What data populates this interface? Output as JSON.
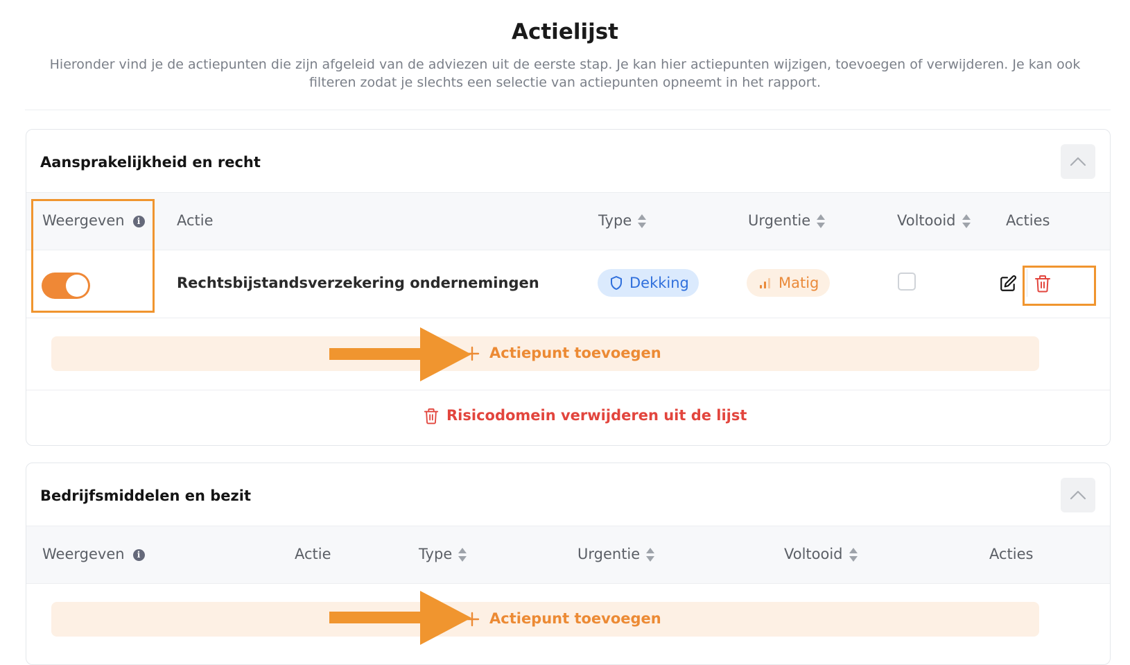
{
  "header": {
    "title": "Actielijst",
    "intro": "Hieronder vind je de actiepunten die zijn afgeleid van de adviezen uit de eerste stap. Je kan hier actiepunten wijzigen, toevoegen of verwijderen. Je kan ook filteren zodat je slechts een selectie van actiepunten opneemt in het rapport."
  },
  "colors": {
    "accent": "#ef8836",
    "danger": "#e2453d",
    "type_badge_bg": "#dbeafd",
    "type_badge_text": "#2f6fdc",
    "urgency_badge_bg": "#fdf0e3",
    "highlight": "#f0952f"
  },
  "sections": [
    {
      "title": "Aansprakelijkheid en recht",
      "collapse_icon": "chevron-up-icon",
      "columns": {
        "show": "Weergeven",
        "action": "Actie",
        "type": "Type",
        "urgency": "Urgentie",
        "done": "Voltooid",
        "actions": "Acties"
      },
      "rows": [
        {
          "show": true,
          "action": "Rechtsbijstandsverzekering ondernemingen",
          "type": "Dekking",
          "type_icon": "shield-icon",
          "urgency": "Matig",
          "urgency_icon": "signal-bars-icon",
          "done": false,
          "edit_icon": "edit-icon",
          "delete_icon": "trash-icon"
        }
      ],
      "add_label": "Actiepunt toevoegen",
      "remove_label": "Risicodomein verwijderen uit de lijst"
    },
    {
      "title": "Bedrijfsmiddelen en bezit",
      "collapse_icon": "chevron-up-icon",
      "columns": {
        "show": "Weergeven",
        "action": "Actie",
        "type": "Type",
        "urgency": "Urgentie",
        "done": "Voltooid",
        "actions": "Acties"
      },
      "rows": [],
      "add_label": "Actiepunt toevoegen"
    }
  ]
}
